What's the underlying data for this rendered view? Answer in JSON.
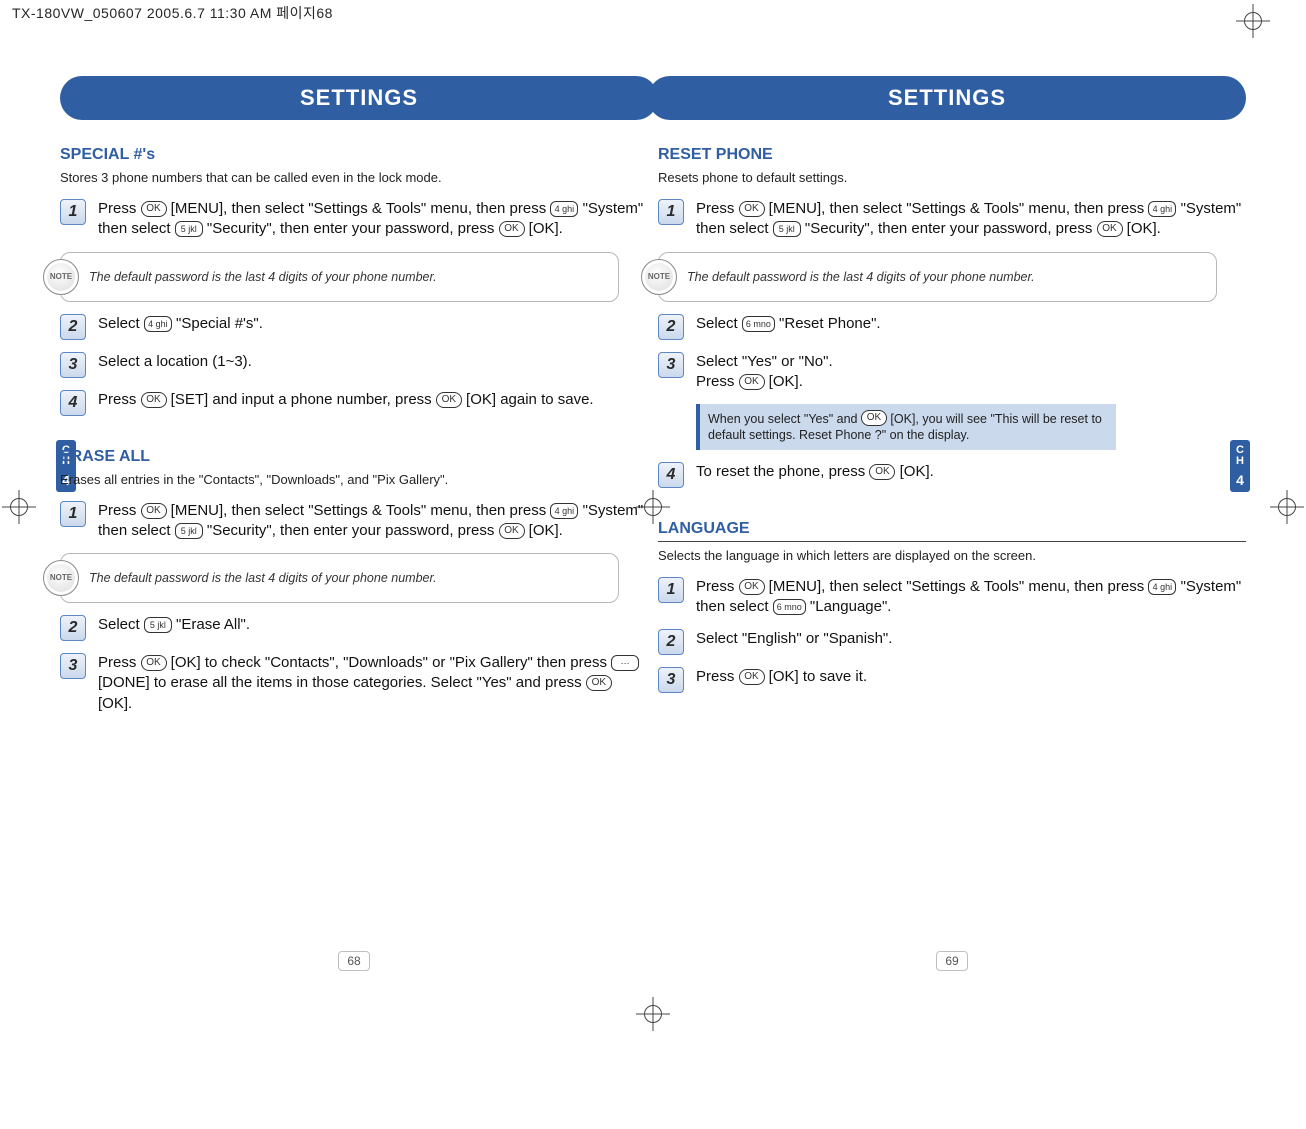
{
  "print_header": "TX-180VW_050607  2005.6.7 11:30 AM  페이지68",
  "banner_title": "SETTINGS",
  "chapter_tab": {
    "c": "C",
    "h": "H",
    "n": "4"
  },
  "left_page": {
    "page_number": "68",
    "sections": [
      {
        "title": "SPECIAL #'s",
        "subtitle": "Stores 3 phone numbers that can be called even in the lock mode.",
        "items": [
          {
            "type": "step",
            "num": "1",
            "html": "Press <span class='ok'>OK</span> [MENU], then select \"Settings & Tools\" menu, then press <span class='key4'>4 ghi</span> \"System\" then select <span class='key5'>5 jkl</span> \"Security\", then enter your password, press <span class='ok'>OK</span> [OK]."
          },
          {
            "type": "note",
            "text": "The default password is the last 4 digits of your phone number."
          },
          {
            "type": "step",
            "num": "2",
            "html": "Select <span class='key4'>4 ghi</span> \"Special #'s\"."
          },
          {
            "type": "step",
            "num": "3",
            "html": "Select a location (1~3)."
          },
          {
            "type": "step",
            "num": "4",
            "html": "Press <span class='ok'>OK</span> [SET] and input a phone number, press <span class='ok'>OK</span> [OK] again to save."
          }
        ]
      },
      {
        "title": "ERASE ALL",
        "subtitle": "Erases all entries in the \"Contacts\", \"Downloads\", and \"Pix Gallery\".",
        "items": [
          {
            "type": "step",
            "num": "1",
            "html": "Press <span class='ok'>OK</span> [MENU], then select \"Settings & Tools\" menu, then press <span class='key4'>4 ghi</span> \"System\" then select <span class='key5'>5 jkl</span> \"Security\", then enter your password, press <span class='ok'>OK</span> [OK]."
          },
          {
            "type": "note",
            "text": "The default password is the last 4 digits of your phone number."
          },
          {
            "type": "step",
            "num": "2",
            "html": "Select <span class='key5'>5 jkl</span> \"Erase All\"."
          },
          {
            "type": "step",
            "num": "3",
            "html": "Press <span class='ok'>OK</span> [OK] to check \"Contacts\", \"Downloads\" or \"Pix Gallery\" then press <span class='keydone'>⋯</span> [DONE] to erase all the items in those categories. Select \"Yes\" and press <span class='ok'>OK</span> [OK]."
          }
        ]
      }
    ]
  },
  "right_page": {
    "page_number": "69",
    "sections": [
      {
        "title": "RESET PHONE",
        "subtitle": "Resets phone to default settings.",
        "items": [
          {
            "type": "step",
            "num": "1",
            "html": "Press <span class='ok'>OK</span> [MENU], then select \"Settings & Tools\" menu, then press <span class='key4'>4 ghi</span> \"System\" then select <span class='key5'>5 jkl</span> \"Security\", then enter your password, press <span class='ok'>OK</span> [OK]."
          },
          {
            "type": "note",
            "text": "The default password is the last 4 digits of your phone number."
          },
          {
            "type": "step",
            "num": "2",
            "html": "Select <span class='key6'>6 mno</span> \"Reset Phone\"."
          },
          {
            "type": "step",
            "num": "3",
            "html": "Select \"Yes\" or \"No\".<br>Press <span class='ok'>OK</span> [OK]."
          },
          {
            "type": "info",
            "html": "When you select \"Yes\" and <span class='ok'>OK</span> [OK], you will see \"This will be reset to default settings. Reset Phone ?\" on the display."
          },
          {
            "type": "step",
            "num": "4",
            "html": "To reset the phone, press <span class='ok'>OK</span> [OK]."
          }
        ]
      },
      {
        "title": "LANGUAGE",
        "title_major": true,
        "subtitle": "Selects the language in which letters are displayed on the screen.",
        "items": [
          {
            "type": "step",
            "num": "1",
            "html": "Press <span class='ok'>OK</span> [MENU], then select \"Settings & Tools\" menu, then press <span class='key4'>4 ghi</span> \"System\" then select <span class='key6'>6 mno</span> \"Language\"."
          },
          {
            "type": "step",
            "num": "2",
            "html": "Select \"English\" or \"Spanish\"."
          },
          {
            "type": "step",
            "num": "3",
            "html": "Press <span class='ok'>OK</span> [OK] to save it."
          }
        ]
      }
    ]
  }
}
